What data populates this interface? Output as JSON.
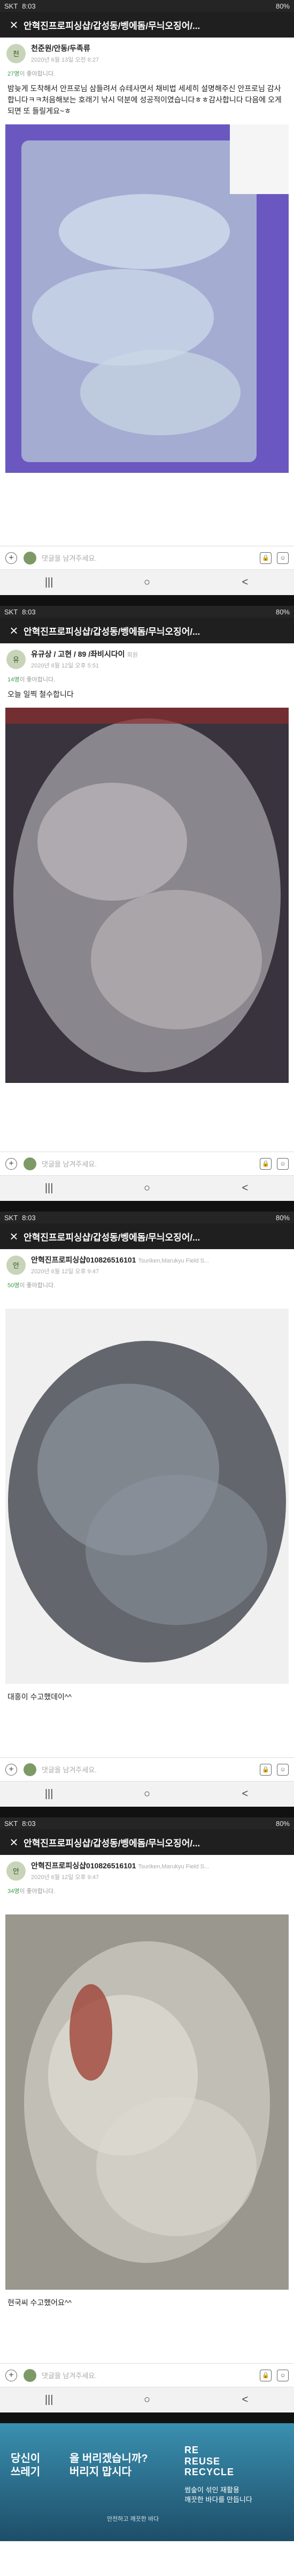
{
  "status": {
    "carrier": "SKT",
    "time": "8:03",
    "battery": "80%"
  },
  "app": {
    "title": "안혁진프로피싱샵/갑성동/벵에돔/무늬오징어/..."
  },
  "posts": [
    {
      "author": "천준원/안동/두족류",
      "author_sub": "",
      "avatar_text": "천",
      "date": "2020년 6월 13일 오전 6:27",
      "likes_count": "27명",
      "likes_rest": "이 좋아합니다.",
      "body": "밤늦게 도착해서 안프로님 삼들려서 슈테사면서 채비법  세세히 설명해주신  안프로님 감사합니다ㅋㅋ처음해보는 호래기 낚시 덕분에 성공적이였습니다ㅎㅎ감사합니다 다음에 오게되면 또 들릴게요~ㅎ",
      "caption": ""
    },
    {
      "author": "유규상 / 고현 / 89 /좌비시다이",
      "author_sub": "회원",
      "avatar_text": "유",
      "date": "2020년 6월 12일 오후 5:51",
      "likes_count": "14명",
      "likes_rest": "이 좋아합니다.",
      "body": "오늘 일찍 철수합니다",
      "caption": ""
    },
    {
      "author": "안혁진프로피싱샵010826516101",
      "author_sub": "Tsuriken,Marukyu Field S...",
      "avatar_text": "안",
      "date": "2020년 6월 12일 오후 9:47",
      "likes_count": "50명",
      "likes_rest": "이 좋아합니다.",
      "body": "",
      "caption": "대흥이 수고했데이^^"
    },
    {
      "author": "안혁진프로피싱샵010826516101",
      "author_sub": "Tsuriken,Marukyu Field S...",
      "avatar_text": "안",
      "date": "2020년 6월 12일 오후 9:47",
      "likes_count": "34명",
      "likes_rest": "이 좋아합니다.",
      "body": "",
      "caption": "현국씨 수고했어요^^"
    }
  ],
  "comment_placeholder": "댓글을 남겨주세요.",
  "nav": {
    "recent": "|||",
    "home": "○",
    "back": "<"
  },
  "ad": {
    "line1": "당신이",
    "line2": "쓰레기",
    "line3": "을 버리겠습니까?",
    "line4": "버리지 맙시다",
    "right1": "RE\nREUSE\nRECYCLE",
    "right2": "썸숲이 섞인 재활용\n깨끗한 바다를 만듭니다",
    "small": "안전하고 깨끗한 바다"
  }
}
